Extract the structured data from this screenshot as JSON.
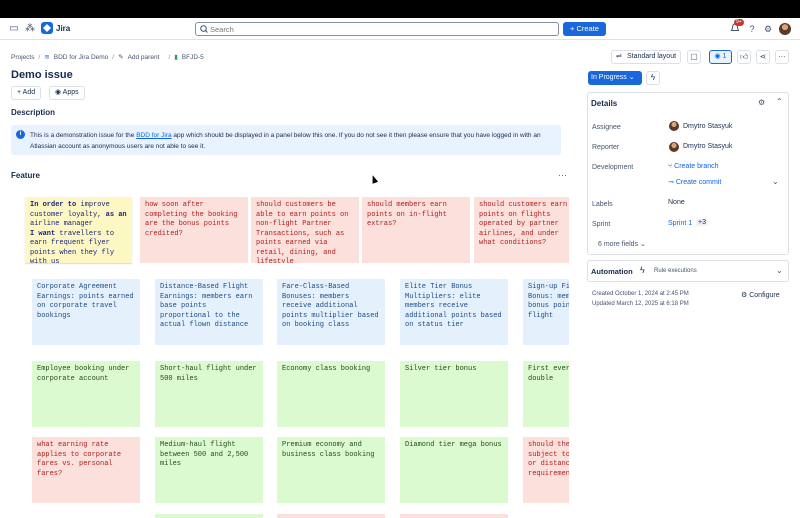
{
  "nav": {
    "app_name": "Jira",
    "search_placeholder": "Search",
    "create_label": "Create",
    "notif_count": "9+"
  },
  "breadcrumb": {
    "projects": "Projects",
    "project": "BDD for Jira Demo",
    "add_parent": "Add parent",
    "issue_key": "BFJD-5"
  },
  "issue": {
    "title": "Demo issue",
    "add_label": "Add",
    "apps_label": "Apps",
    "description_heading": "Description",
    "description_pre": "This is a demonstration issue for the ",
    "description_link": "BDD for Jira",
    "description_post": " app which should be displayed in a panel below this one. If you do not see it then please ensure that you have logged in with an Atlassian account as anonymous users are not able to see it.",
    "feature_heading": "Feature"
  },
  "board": {
    "row1": [
      {
        "color": "yellow",
        "text": "In order to improve customer loyalty, as an airline manager I want travellers to earn frequent flyer points when they fly with us"
      },
      {
        "color": "pink",
        "text": "how soon after completing the booking are the bonus points credited?"
      },
      {
        "color": "pink",
        "text": "should customers be able to earn points on non-flight Partner Transactions, such as points earned via retail, dining, and lifestyle"
      },
      {
        "color": "pink",
        "text": "should members earn points on in-flight extras?"
      },
      {
        "color": "pink",
        "text": "should customers earn points on flights operated by partner airlines, and under what conditions?"
      }
    ],
    "row2": [
      {
        "color": "blue",
        "text": "Corporate Agreement Earnings: points earned on corporate travel bookings"
      },
      {
        "color": "blue",
        "text": "Distance-Based Flight Earnings: members earn base points proportional to the actual flown distance"
      },
      {
        "color": "blue",
        "text": "Fare-Class-Based Bonuses: members receive additional points multiplier based on booking class"
      },
      {
        "color": "blue",
        "text": "Elite Tier Bonus Multipliers: elite members receive additional points based on status tier"
      },
      {
        "color": "blue",
        "text": "Sign-up First Flight Bonus: members earn bonus points for first flight"
      }
    ],
    "row3": [
      {
        "color": "green",
        "text": "Employee booking under corporate account"
      },
      {
        "color": "green",
        "text": "Short-haul flight under 500 miles"
      },
      {
        "color": "green",
        "text": "Economy class booking"
      },
      {
        "color": "green",
        "text": "Silver tier bonus"
      },
      {
        "color": "green",
        "text": "First ever flight earns double"
      }
    ],
    "row4": [
      {
        "color": "pink",
        "text": "what earning rate applies to corporate fares vs. personal fares?"
      },
      {
        "color": "green",
        "text": "Medium-haul flight between 500 and 2,500 miles"
      },
      {
        "color": "green",
        "text": "Premium economy and business class booking"
      },
      {
        "color": "green",
        "text": "Diamond tier mega bonus"
      },
      {
        "color": "pink",
        "text": "should the bonus be subject to fare class or distance requirement?"
      }
    ]
  },
  "sidebar": {
    "standard_layout": "Standard layout",
    "watch_count": "1",
    "status": "In Progress",
    "details_heading": "Details",
    "assignee_label": "Assignee",
    "assignee": "Dmytro Stasyuk",
    "reporter_label": "Reporter",
    "reporter": "Dmytro Stasyuk",
    "development_label": "Development",
    "create_branch": "Create branch",
    "create_commit": "Create commit",
    "labels_label": "Labels",
    "labels_value": "None",
    "sprint_label": "Sprint",
    "sprint_value": "Sprint 1",
    "sprint_more": "+3",
    "more_fields": "6 more fields",
    "automation": "Automation",
    "rule_executions": "Rule executions",
    "created": "Created October 1, 2024 at 2:45 PM",
    "updated": "Updated March 12, 2025 at 6:18 PM",
    "configure": "Configure"
  }
}
